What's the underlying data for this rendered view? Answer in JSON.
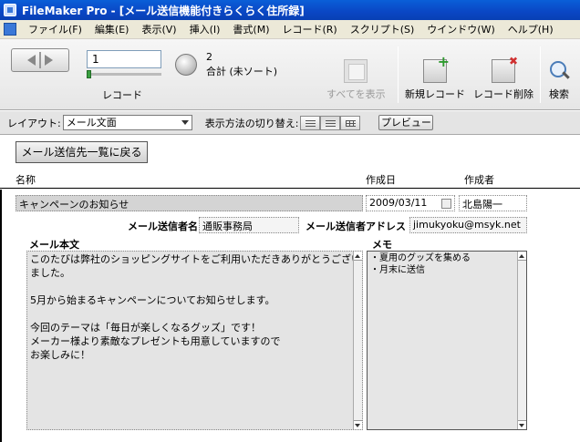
{
  "window": {
    "title": "FileMaker Pro - [メール送信機能付きらくらく住所録]"
  },
  "menu": [
    "ファイル(F)",
    "編集(E)",
    "表示(V)",
    "挿入(I)",
    "書式(M)",
    "レコード(R)",
    "スクリプト(S)",
    "ウインドウ(W)",
    "ヘルプ(H)"
  ],
  "status": {
    "record_number": "1",
    "record_label": "レコード",
    "total_count": "2",
    "total_label": "合計 (未ソート)",
    "show_all": "すべてを表示",
    "new_record": "新規レコード",
    "delete_record": "レコード削除",
    "find": "検索"
  },
  "layoutbar": {
    "layout_label": "レイアウト:",
    "layout_value": "メール文面",
    "view_label": "表示方法の切り替え:",
    "preview": "プレビュー"
  },
  "header": {
    "back_button": "メール送信先一覧に戻る",
    "col_name": "名称",
    "col_date": "作成日",
    "col_author": "作成者"
  },
  "record": {
    "subject": "キャンペーンのお知らせ",
    "date": "2009/03/11",
    "author": "北島陽一",
    "sender_label": "メール送信者名",
    "sender": "通販事務局",
    "address_label": "メール送信者アドレス",
    "address": "jimukyoku@msyk.net",
    "body_label": "メール本文",
    "memo_label": "メモ",
    "body_lines": [
      "このたびは弊社のショッピングサイトをご利用いただきありがとうござい",
      "ました。",
      "",
      "5月から始まるキャンペーンについてお知らせします。",
      "",
      "今回のテーマは「毎日が楽しくなるグッズ」です！",
      "メーカー様より素敵なプレゼントも用意していますので",
      "お楽しみに！"
    ],
    "memo_lines": [
      "・夏用のグッズを集める",
      "・月末に送信"
    ]
  }
}
